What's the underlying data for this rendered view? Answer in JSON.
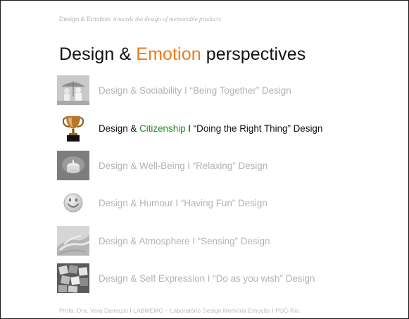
{
  "header": {
    "prefix": "Design & Emotion: ",
    "subtitle": "towards the design of memorable products"
  },
  "title": {
    "part1": "Design & ",
    "accent": "Emotion",
    "part2": " perspectives"
  },
  "colors": {
    "accent_orange": "#ef7a1a",
    "accent_green": "#1e8a2c",
    "muted_text": "#b3b3b3",
    "active_text": "#111111"
  },
  "perspectives": [
    {
      "icon": "people-under-umbrella-photo-icon",
      "pre": "Design & Sociability I “Being Together” Design",
      "hl": "",
      "post": "",
      "active": false
    },
    {
      "icon": "trophy-icon",
      "pre": "Design & ",
      "hl": "Citizenship",
      "post": " I “Doing the Right Thing” Design",
      "active": true
    },
    {
      "icon": "candle-photo-icon",
      "pre": "Design & Well-Being I “Relaxing” Design",
      "hl": "",
      "post": "",
      "active": false
    },
    {
      "icon": "smiley-face-icon",
      "pre": "Design & Humour I “Having Fun” Design",
      "hl": "",
      "post": "",
      "active": false
    },
    {
      "icon": "hands-photo-icon",
      "pre": "Design & Atmosphere I “Sensing” Design",
      "hl": "",
      "post": "",
      "active": false
    },
    {
      "icon": "letter-blocks-photo-icon",
      "pre": "Design & Self Expression I “Do as you wish” Design",
      "hl": "",
      "post": "",
      "active": false
    }
  ],
  "footer": {
    "text": "Profa. Dra. Vera Damazio I LABMEMO – Laboratório Design Memória Emoção I PUC-Rio"
  }
}
